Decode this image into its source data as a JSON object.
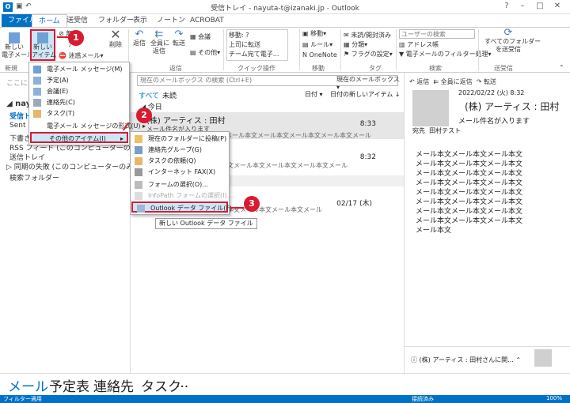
{
  "window": {
    "title": "受信トレイ - nayuta-t@izanaki.jp - Outlook"
  },
  "tabs": [
    "ファイル",
    "ホーム",
    "送受信",
    "フォルダー",
    "表示",
    "ノートン",
    "ACROBAT"
  ],
  "ribbon": {
    "new_email": "新しい\n電子メール",
    "new_items": "新しい\nアイテム",
    "ignore": "無視",
    "cleanup": "クリーンアップ",
    "junk": "迷惑メール",
    "delete": "削除",
    "reply": "返信",
    "reply_all": "全員に\n返信",
    "forward": "転送",
    "meeting": "会議",
    "more": "その他",
    "quick_steps": [
      "移動: ?",
      "上司に転送",
      "チーム宛て電子..."
    ],
    "move": "移動",
    "rules": "ルール",
    "onenote": "OneNote",
    "unread_read": "未読/開封済み",
    "categorize": "分類",
    "followup": "フラグの設定",
    "search_people": "ユーザーの検索",
    "address_book": "アドレス帳",
    "filter_email": "電子メールのフィルター処理",
    "send_receive_all": "すべてのフォルダー\nを送受信",
    "groups": {
      "new": "新規",
      "respond": "返信",
      "quick_steps": "クイック操作",
      "move": "移動",
      "tags": "タグ",
      "find": "検索",
      "send_receive": "送受信"
    }
  },
  "folder_pane": {
    "hint": "ここにお気に入りのフォルダーを...",
    "account": "nayuta",
    "folders": [
      "受信トレイ",
      "Sent",
      "下書き",
      "RSS フィード (このコンピューターのみ)",
      "送信トレイ",
      "同期の失敗 (このコンピューターのみ)",
      "検索フォルダー"
    ]
  },
  "message_list": {
    "search_placeholder": "現在のメールボックス の検索 (Ctrl+E)",
    "scope": "現在のメールボックス",
    "filters": {
      "all": "すべて",
      "unread": "未読"
    },
    "sort": {
      "by": "日付",
      "order": "日付の新しいアイテム"
    },
    "group_today": "今日",
    "messages": [
      {
        "from": "(株) アーティス : 田村",
        "subject": "メール件名が入ります",
        "preview": "メール本文メール本文メール本文メール本文メール",
        "time": "8:33"
      },
      {
        "from": "",
        "subject": "",
        "preview": "文メール本文メール本文メール本文メール",
        "time": "8:32"
      },
      {
        "from": "",
        "subject": "",
        "preview": "本文メール本文メール本文メール",
        "time": "02/17 (木)"
      }
    ]
  },
  "reading_pane": {
    "actions": {
      "reply": "返信",
      "reply_all": "全員に返信",
      "forward": "転送"
    },
    "date": "2022/02/22 (火) 8:32",
    "from": "(株) アーティス : 田村",
    "subject": "メール件名が入ります",
    "to_label": "宛先",
    "to": "田村テスト",
    "body": [
      "メール本文メール本文メール本文",
      "メール本文メール本文メール本文",
      "メール本文メール本文メール本文",
      "メール本文メール本文メール本文",
      "メール本文メール本文メール本文",
      "メール本文メール本文メール本文",
      "メール本文メール本文メール本文",
      "メール本文メール本文メール本文",
      "メール本文"
    ],
    "people_pane": "(株) アーティス : 田村さんに関..."
  },
  "new_items_menu": {
    "items": [
      {
        "label": "電子メール メッセージ(M)",
        "disabled": false
      },
      {
        "label": "予定(A)",
        "disabled": false
      },
      {
        "label": "会議(E)",
        "disabled": false
      },
      {
        "label": "連絡先(C)",
        "disabled": false
      },
      {
        "label": "タスク(T)",
        "disabled": false
      },
      {
        "label": "電子メール メッセージの形式(U)",
        "disabled": false
      },
      {
        "label": "その他のアイテム(I)",
        "disabled": false
      }
    ]
  },
  "other_items_menu": {
    "items": [
      {
        "label": "現在のフォルダーに投稿(P)",
        "disabled": false
      },
      {
        "label": "連絡先グループ(G)",
        "disabled": false
      },
      {
        "label": "タスクの依頼(Q)",
        "disabled": false
      },
      {
        "label": "インターネット FAX(X)",
        "disabled": false
      },
      {
        "label": "フォームの選択(O)...",
        "disabled": false
      },
      {
        "label": "InfoPath フォームの選択(I)...",
        "disabled": true
      },
      {
        "label": "Outlook データ ファイル(F)...",
        "disabled": false
      }
    ]
  },
  "tooltip": "新しい Outlook データ ファイル",
  "callouts": [
    "1",
    "2",
    "3"
  ],
  "nav": {
    "mail": "メール",
    "calendar": "予定表",
    "people": "連絡先",
    "tasks": "タスク",
    "more": "..."
  },
  "status": {
    "left": "フィルター適用",
    "connected": "接続済み",
    "zoom": "100%"
  },
  "colors": {
    "accent": "#0072c6",
    "callout": "#d81b30",
    "highlight": "#cde6f7"
  }
}
